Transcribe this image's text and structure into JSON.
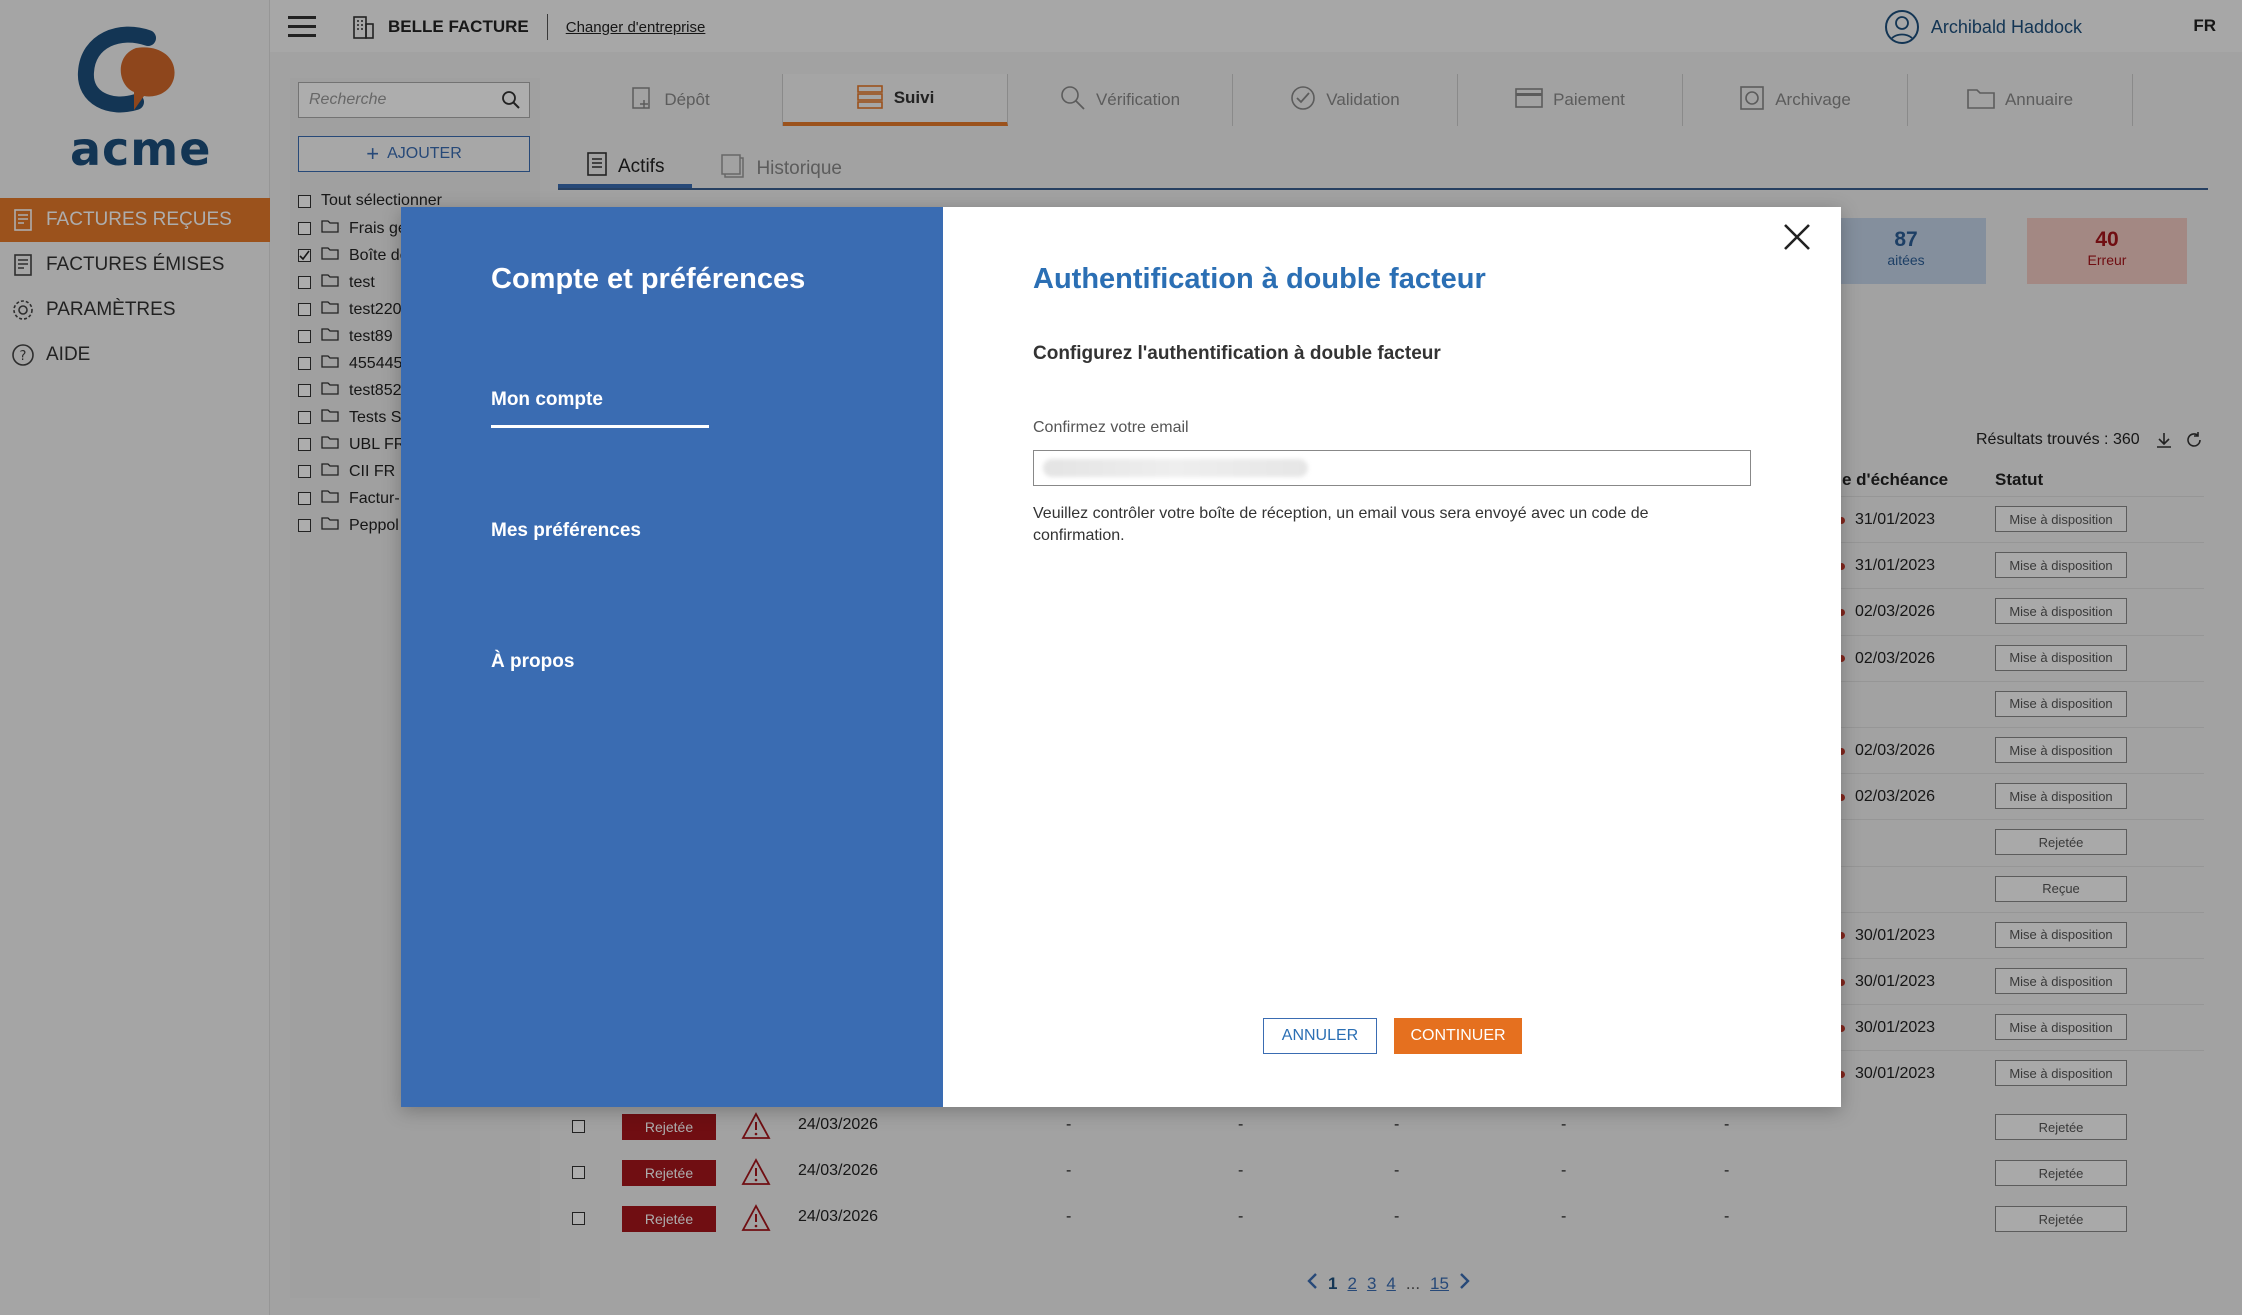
{
  "brand": {
    "logo_text": "acme",
    "accent": "#e5792a",
    "primary": "#3a6cb2"
  },
  "sidebar": {
    "items": [
      {
        "label": "FACTURES REÇUES",
        "icon": "invoice-in-icon",
        "active": true
      },
      {
        "label": "FACTURES ÉMISES",
        "icon": "invoice-out-icon"
      },
      {
        "label": "PARAMÈTRES",
        "icon": "gear-icon"
      },
      {
        "label": "AIDE",
        "icon": "help-icon"
      }
    ]
  },
  "topbar": {
    "company": "BELLE FACTURE",
    "change_company": "Changer d'entreprise",
    "user": "Archibald Haddock",
    "lang": "FR"
  },
  "leftpanel": {
    "search_placeholder": "Recherche",
    "add_label": "AJOUTER",
    "select_all": "Tout sélectionner",
    "folders": [
      {
        "label": "Frais gé",
        "checked": false
      },
      {
        "label": "Boîte de",
        "checked": true
      },
      {
        "label": "test",
        "checked": false
      },
      {
        "label": "test220",
        "checked": false
      },
      {
        "label": "test89",
        "checked": false
      },
      {
        "label": "455445",
        "checked": false
      },
      {
        "label": "test852",
        "checked": false
      },
      {
        "label": "Tests ST",
        "checked": false
      },
      {
        "label": "UBL FR",
        "checked": false
      },
      {
        "label": "CII FR",
        "checked": false
      },
      {
        "label": "Factur-",
        "checked": false
      },
      {
        "label": "Peppol",
        "checked": false
      }
    ]
  },
  "modules": [
    {
      "label": "Dépôt"
    },
    {
      "label": "Suivi",
      "active": true
    },
    {
      "label": "Vérification"
    },
    {
      "label": "Validation"
    },
    {
      "label": "Paiement"
    },
    {
      "label": "Archivage"
    },
    {
      "label": "Annuaire"
    }
  ],
  "subtabs": [
    {
      "label": "Actifs",
      "active": true
    },
    {
      "label": "Historique"
    }
  ],
  "kpis": [
    {
      "value": "87",
      "label": "aitées"
    },
    {
      "value": "40",
      "label": "Erreur"
    }
  ],
  "table": {
    "results": "Résultats trouvés : 360",
    "col_due": "e d'échéance",
    "col_status": "Statut",
    "rows": [
      {
        "due": "31/01/2023",
        "status": "Mise à disposition"
      },
      {
        "due": "31/01/2023",
        "status": "Mise à disposition"
      },
      {
        "due": "02/03/2026",
        "status": "Mise à disposition"
      },
      {
        "due": "02/03/2026",
        "status": "Mise à disposition"
      },
      {
        "due": "",
        "status": "Mise à disposition"
      },
      {
        "due": "02/03/2026",
        "status": "Mise à disposition"
      },
      {
        "due": "02/03/2026",
        "status": "Mise à disposition"
      },
      {
        "due": "",
        "status": "Rejetée"
      },
      {
        "due": "",
        "status": "Reçue"
      },
      {
        "due": "30/01/2023",
        "status": "Mise à disposition"
      },
      {
        "due": "30/01/2023",
        "status": "Mise à disposition"
      },
      {
        "due": "30/01/2023",
        "status": "Mise à disposition"
      },
      {
        "due": "30/01/2023",
        "status": "Mise à disposition"
      }
    ],
    "rejected_rows": [
      {
        "badge": "Rejetée",
        "date": "24/03/2026",
        "dash": "-",
        "status": "Rejetée"
      },
      {
        "badge": "Rejetée",
        "date": "24/03/2026",
        "dash": "-",
        "status": "Rejetée"
      },
      {
        "badge": "Rejetée",
        "date": "24/03/2026",
        "dash": "-",
        "status": "Rejetée"
      }
    ]
  },
  "pager": {
    "pages": [
      "1",
      "2",
      "3",
      "4"
    ],
    "ellipsis": "...",
    "last": "15"
  },
  "modal": {
    "left_title": "Compte et préférences",
    "nav": [
      {
        "label": "Mon compte",
        "active": true
      },
      {
        "label": "Mes préférences"
      },
      {
        "label": "À propos"
      }
    ],
    "title": "Authentification à double facteur",
    "subtitle": "Configurez l'authentification à double facteur",
    "email_label": "Confirmez votre email",
    "email_value": "",
    "help": "Veuillez contrôler votre boîte de réception, un email vous sera envoyé avec un code de confirmation.",
    "cancel": "ANNULER",
    "continue": "CONTINUER"
  }
}
